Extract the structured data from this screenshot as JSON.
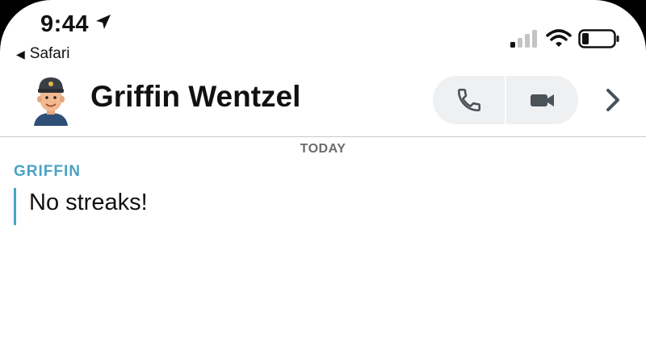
{
  "status_bar": {
    "time": "9:44",
    "back_app": "Safari",
    "icons": [
      "location-arrow-icon",
      "cellular-signal-icon",
      "wifi-icon",
      "battery-icon"
    ]
  },
  "chat_header": {
    "contact_name": "Griffin Wentzel",
    "avatar": "bitmoji-avatar",
    "buttons": [
      "phone-icon",
      "video-camera-icon",
      "chevron-right-icon"
    ]
  },
  "conversation": {
    "date_label": "TODAY",
    "messages": [
      {
        "sender": "GRIFFIN",
        "text": "No streaks!"
      }
    ]
  },
  "colors": {
    "sender_accent": "#4aa3c5",
    "call_button_bg": "#eef0f2",
    "icon_gray": "#4b5258"
  }
}
